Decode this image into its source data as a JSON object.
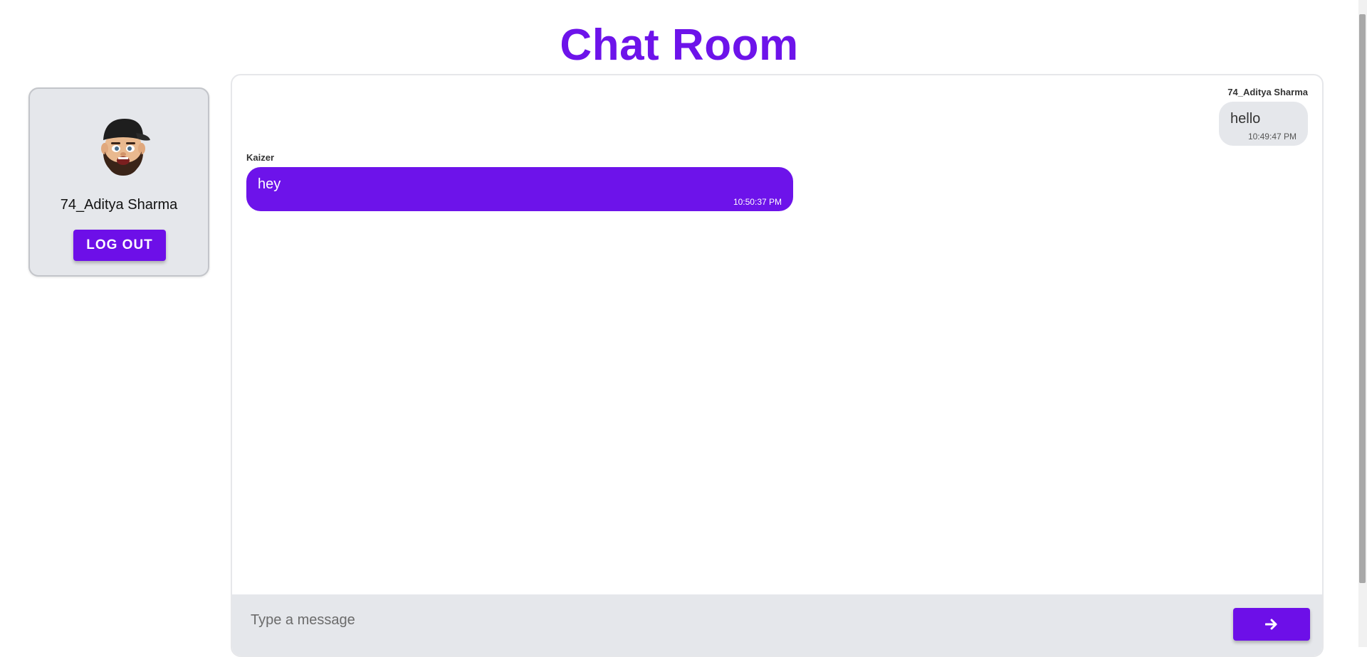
{
  "page": {
    "title": "Chat Room"
  },
  "colors": {
    "accent": "#6d13ea",
    "card_bg": "#e5e7eb"
  },
  "profile": {
    "avatar_icon": "memoji-avatar",
    "name": "74_Aditya Sharma",
    "logout_label": "LOG OUT"
  },
  "messages": [
    {
      "sender": "74_Aditya Sharma",
      "text": "hello",
      "time": "10:49:47 PM",
      "own": true
    },
    {
      "sender": "Kaizer",
      "text": "hey",
      "time": "10:50:37 PM",
      "own": false
    }
  ],
  "composer": {
    "placeholder": "Type a message",
    "value": "",
    "send_icon": "arrow-right-icon"
  }
}
